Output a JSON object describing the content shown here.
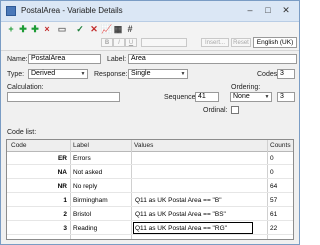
{
  "window": {
    "title": "PostalArea - Variable Details"
  },
  "format_bar": {
    "insert_label": "Insert...",
    "reset_label": "Reset",
    "language": "English (UK)"
  },
  "form": {
    "name_label": "Name:",
    "name_value": "PostalArea",
    "label_label": "Label:",
    "label_value": "Area",
    "type_label": "Type:",
    "type_value": "Derived",
    "response_label": "Response:",
    "response_value": "Single",
    "codes_label": "Codes:",
    "codes_value": "3",
    "calculation_label": "Calculation:",
    "sequence_label": "Sequence:",
    "sequence_value": "41",
    "ordering_label": "Ordering:",
    "ordering_value": "None",
    "ordering_number": "3",
    "ordinal_label": "Ordinal:"
  },
  "code_list": {
    "title": "Code list:",
    "headers": [
      "Code",
      "Label",
      "Values",
      "Counts"
    ],
    "rows": [
      {
        "code": "ER",
        "label": "Errors",
        "values": "",
        "count": "0"
      },
      {
        "code": "NA",
        "label": "Not asked",
        "values": "",
        "count": "0"
      },
      {
        "code": "NR",
        "label": "No reply",
        "values": "",
        "count": "64"
      },
      {
        "code": "1",
        "label": "Birmingham",
        "values": "Q11 as UK Postal Area == \"B\"",
        "count": "57"
      },
      {
        "code": "2",
        "label": "Bristol",
        "values": "Q11 as UK Postal Area == \"BS\"",
        "count": "61"
      },
      {
        "code": "3",
        "label": "Reading",
        "values": "Q11 as UK Postal Area == \"RG\"",
        "count": "22"
      }
    ]
  }
}
